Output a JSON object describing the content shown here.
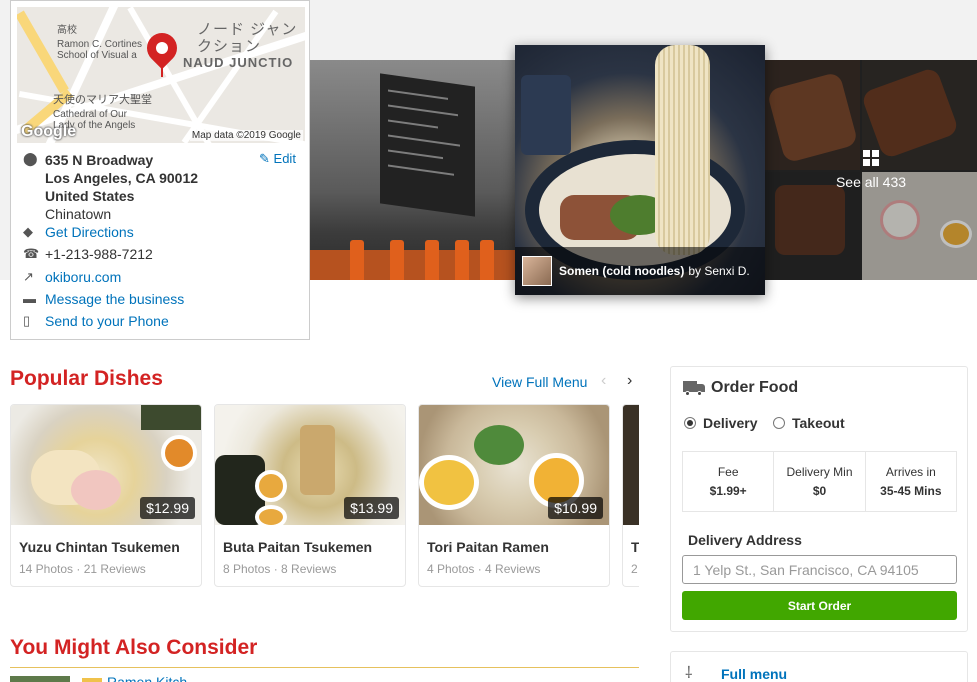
{
  "map": {
    "credit": "Map data ©2019 Google",
    "google_logo": "Google",
    "labels": {
      "jp_top": "高校",
      "school": "Ramon C. Cortines School of Visual a",
      "jp_junction": "ノード ジャンクション",
      "junction": "NAUD JUNCTIO",
      "jp_cathedral": "天使のマリア大聖堂",
      "cathedral": "Cathedral of Our Lady of the Angels"
    }
  },
  "address": {
    "street": "635 N Broadway",
    "city": "Los Angeles, CA 90012",
    "country": "United States",
    "neighborhood": "Chinatown",
    "edit": "Edit",
    "get_directions": "Get Directions",
    "phone": "+1-213-988-7212",
    "website": "okiboru.com",
    "message": "Message the business",
    "send_phone": "Send to your Phone"
  },
  "photos": {
    "main_caption_title": "Somen (cold noodles)",
    "main_caption_by": "by Senxi D.",
    "see_all": "See all 433"
  },
  "popular": {
    "title": "Popular Dishes",
    "view_full_menu": "View Full Menu",
    "dishes": [
      {
        "name": "Yuzu Chintan Tsukemen",
        "price": "$12.99",
        "photos": "14 Photos",
        "reviews": "21 Reviews"
      },
      {
        "name": "Buta Paitan Tsukemen",
        "price": "$13.99",
        "photos": "8 Photos",
        "reviews": "8 Reviews"
      },
      {
        "name": "Tori Paitan Ramen",
        "price": "$10.99",
        "photos": "4 Photos",
        "reviews": "4 Reviews"
      }
    ],
    "partial_initial": "T",
    "partial_meta": "2"
  },
  "consider": {
    "title": "You Might Also Consider",
    "first_link": "Ramen Kitch"
  },
  "order": {
    "title": "Order Food",
    "delivery": "Delivery",
    "takeout": "Takeout",
    "fee_label": "Fee",
    "fee_value": "$1.99+",
    "min_label": "Delivery Min",
    "min_value": "$0",
    "arrives_label": "Arrives in",
    "arrives_value": "35-45 Mins",
    "address_label": "Delivery Address",
    "address_placeholder": "1 Yelp St., San Francisco, CA 94105",
    "start_button": "Start Order"
  },
  "menu": {
    "full_menu": "Full menu"
  },
  "colors": {
    "accent_red": "#d32323",
    "link_blue": "#0073bb",
    "start_green": "#41a700"
  },
  "icons": [
    "map-pin-icon",
    "pencil-icon",
    "directions-icon",
    "phone-icon",
    "external-link-icon",
    "speech-bubble-icon",
    "mobile-phone-icon",
    "grid-icon",
    "chevron-left-icon",
    "chevron-right-icon",
    "truck-icon",
    "fork-knife-icon"
  ]
}
